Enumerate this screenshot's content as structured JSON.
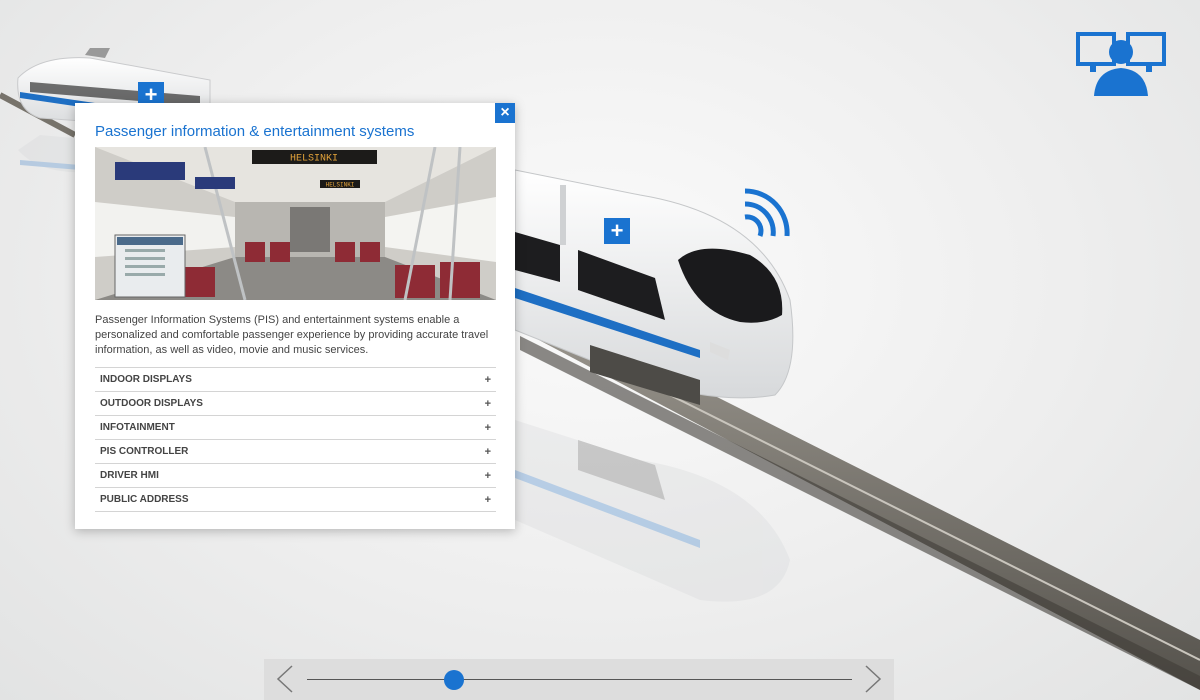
{
  "panel": {
    "title": "Passenger information & entertainment systems",
    "close_label": "×",
    "photo_sign": "HELSINKI",
    "photo_sign_2": "HELSINKI",
    "description": "Passenger Information Systems (PIS) and entertainment systems enable a personalized and comfortable passenger experience by providing accurate travel information, as well as video, movie and music services.",
    "items": [
      {
        "label": "INDOOR DISPLAYS",
        "icon": "+"
      },
      {
        "label": "OUTDOOR DISPLAYS",
        "icon": "+"
      },
      {
        "label": "INFOTAINMENT",
        "icon": "+"
      },
      {
        "label": "PIS CONTROLLER",
        "icon": "+"
      },
      {
        "label": "DRIVER HMI",
        "icon": "+"
      },
      {
        "label": "PUBLIC ADDRESS",
        "icon": "+"
      }
    ]
  },
  "hotspots": {
    "back_train_label": "+",
    "front_train_label": "+"
  },
  "slider": {
    "position": 0.27
  },
  "colors": {
    "accent": "#1a73d0",
    "train_stripe": "#1e6fc4"
  },
  "icons": {
    "operator": "operator-monitor-icon",
    "wifi": "wireless-signal-icon",
    "prev": "chevron-left-icon",
    "next": "chevron-right-icon"
  }
}
